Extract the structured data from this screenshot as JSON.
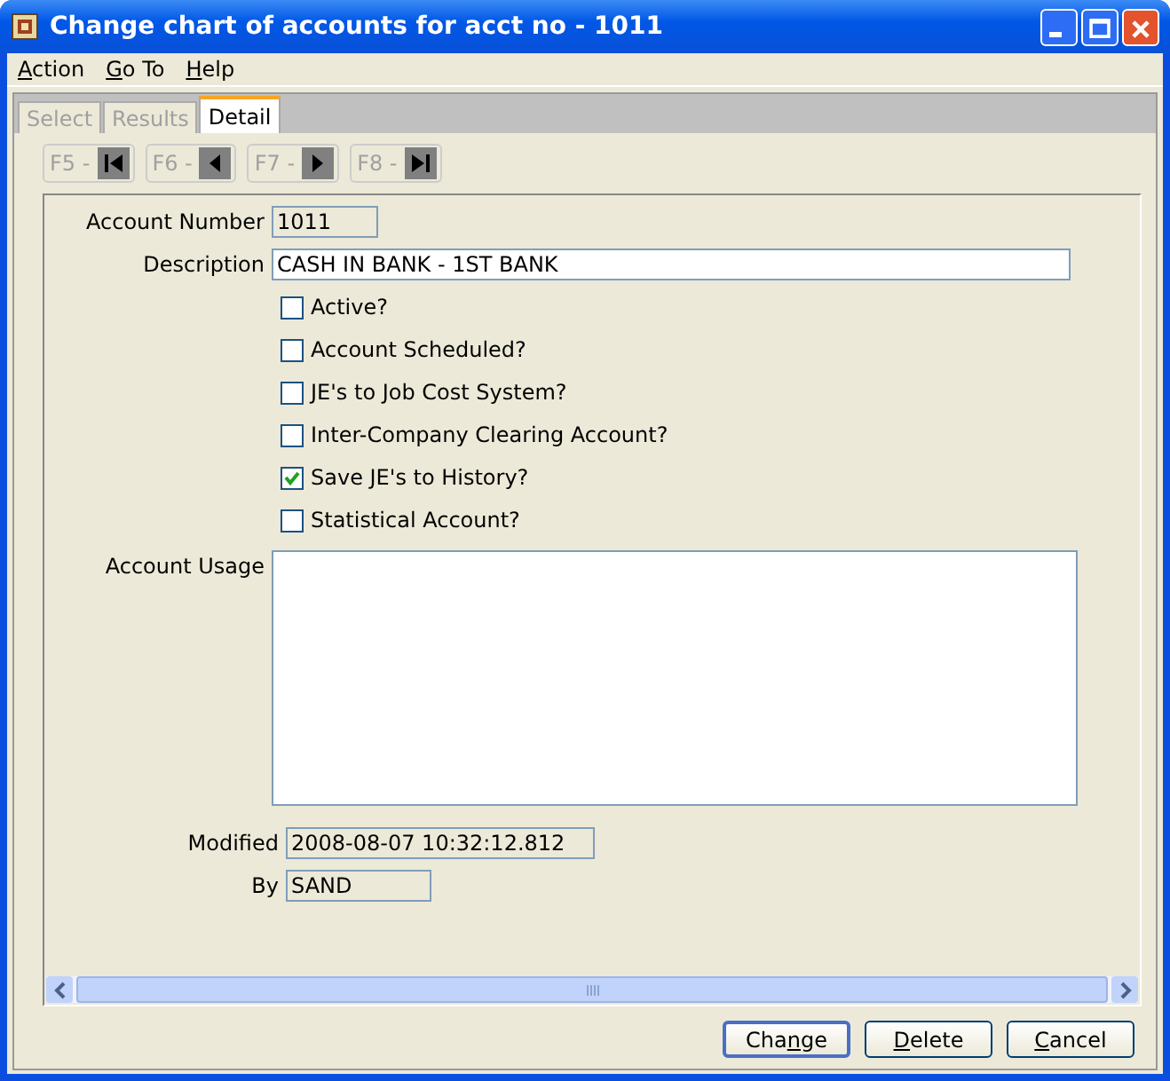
{
  "window": {
    "title": "Change chart of accounts for acct no - 1011"
  },
  "menu": [
    {
      "mnemonic": "A",
      "rest": "ction"
    },
    {
      "mnemonic": "G",
      "rest": "o To"
    },
    {
      "mnemonic": "H",
      "rest": "elp"
    }
  ],
  "tabs": [
    {
      "label": "Select",
      "selected": false
    },
    {
      "label": "Results",
      "selected": false
    },
    {
      "label": "Detail",
      "selected": true
    }
  ],
  "nav_buttons": [
    {
      "label": "F5 -",
      "kind": "first",
      "disabled": true
    },
    {
      "label": "F6 -",
      "kind": "prev",
      "disabled": true
    },
    {
      "label": "F7 -",
      "kind": "next",
      "disabled": true
    },
    {
      "label": "F8 -",
      "kind": "last",
      "disabled": true
    }
  ],
  "account_number": {
    "label": "Account Number",
    "value": "1011"
  },
  "description": {
    "label": "Description",
    "value": "CASH IN BANK - 1ST BANK"
  },
  "checkboxes": [
    {
      "label": "Active?",
      "checked": false
    },
    {
      "label": "Account Scheduled?",
      "checked": false
    },
    {
      "label": "JE's to Job Cost System?",
      "checked": false
    },
    {
      "label": "Inter-Company Clearing Account?",
      "checked": false
    },
    {
      "label": "Save JE's to History?",
      "checked": true
    },
    {
      "label": "Statistical Account?",
      "checked": false
    }
  ],
  "account_usage": {
    "label": "Account Usage"
  },
  "modified": {
    "label": "Modified",
    "value": "2008-08-07 10:32:12.812"
  },
  "by": {
    "label": "By",
    "value": "SAND"
  },
  "buttons": [
    {
      "before": "Cha",
      "mnemonic": "n",
      "rest": "ge",
      "default": true
    },
    {
      "mnemonic": "D",
      "rest": "elete",
      "default": false
    },
    {
      "mnemonic": "C",
      "rest": "ancel",
      "default": false
    }
  ]
}
